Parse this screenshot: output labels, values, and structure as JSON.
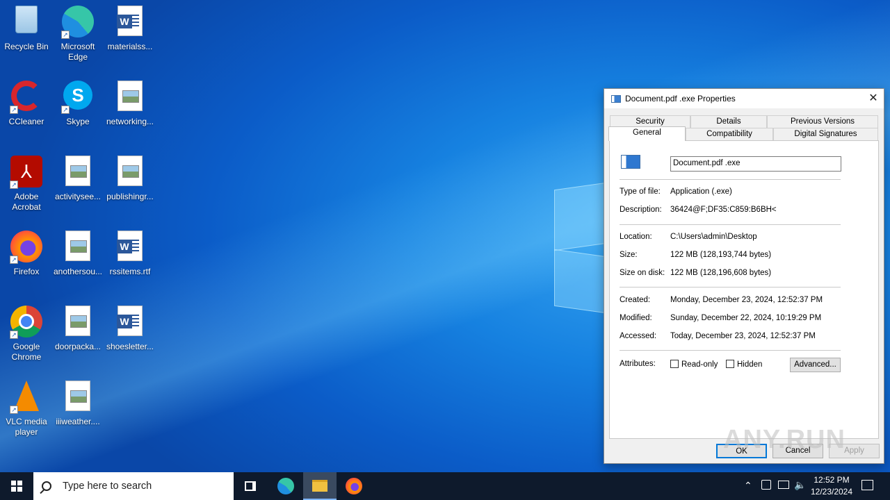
{
  "desktop": {
    "icons": [
      {
        "label": "Recycle Bin",
        "icon": "recycle-bin-icon"
      },
      {
        "label": "Microsoft Edge",
        "icon": "edge-icon"
      },
      {
        "label": "materialss...",
        "icon": "word-doc-icon"
      },
      {
        "label": "CCleaner",
        "icon": "ccleaner-icon"
      },
      {
        "label": "Skype",
        "icon": "skype-icon"
      },
      {
        "label": "networking...",
        "icon": "image-file-icon"
      },
      {
        "label": "Adobe Acrobat",
        "icon": "acrobat-icon"
      },
      {
        "label": "activitysee...",
        "icon": "image-file-icon"
      },
      {
        "label": "publishingr...",
        "icon": "image-file-icon"
      },
      {
        "label": "Firefox",
        "icon": "firefox-icon"
      },
      {
        "label": "anothersou...",
        "icon": "image-file-icon"
      },
      {
        "label": "rssitems.rtf",
        "icon": "word-doc-icon"
      },
      {
        "label": "Google Chrome",
        "icon": "chrome-icon"
      },
      {
        "label": "doorpacka...",
        "icon": "image-file-icon"
      },
      {
        "label": "shoesletter...",
        "icon": "word-doc-icon"
      },
      {
        "label": "VLC media player",
        "icon": "vlc-icon"
      },
      {
        "label": "iiiweather....",
        "icon": "image-file-icon"
      }
    ]
  },
  "dialog": {
    "title": "Document.pdf .exe Properties",
    "tabs_row1": [
      "Security",
      "Details",
      "Previous Versions"
    ],
    "tabs_row2": [
      "General",
      "Compatibility",
      "Digital Signatures"
    ],
    "active_tab": "General",
    "filename": "Document.pdf .exe",
    "fields": {
      "type_label": "Type of file:",
      "type_value": "Application (.exe)",
      "desc_label": "Description:",
      "desc_value": "36424@F;DF35:C859:B6BH<",
      "loc_label": "Location:",
      "loc_value": "C:\\Users\\admin\\Desktop",
      "size_label": "Size:",
      "size_value": "122 MB (128,193,744 bytes)",
      "disk_label": "Size on disk:",
      "disk_value": "122 MB (128,196,608 bytes)",
      "created_label": "Created:",
      "created_value": "Monday, December 23, 2024, 12:52:37 PM",
      "modified_label": "Modified:",
      "modified_value": "Sunday, December 22, 2024, 10:19:29 PM",
      "accessed_label": "Accessed:",
      "accessed_value": "Today, December 23, 2024, 12:52:37 PM",
      "attr_label": "Attributes:",
      "readonly_label": "Read-only",
      "hidden_label": "Hidden"
    },
    "buttons": {
      "advanced": "Advanced...",
      "ok": "OK",
      "cancel": "Cancel",
      "apply": "Apply"
    }
  },
  "taskbar": {
    "search_placeholder": "Type here to search",
    "time": "12:52 PM",
    "date": "12/23/2024"
  },
  "watermark": "ANY.RUN"
}
